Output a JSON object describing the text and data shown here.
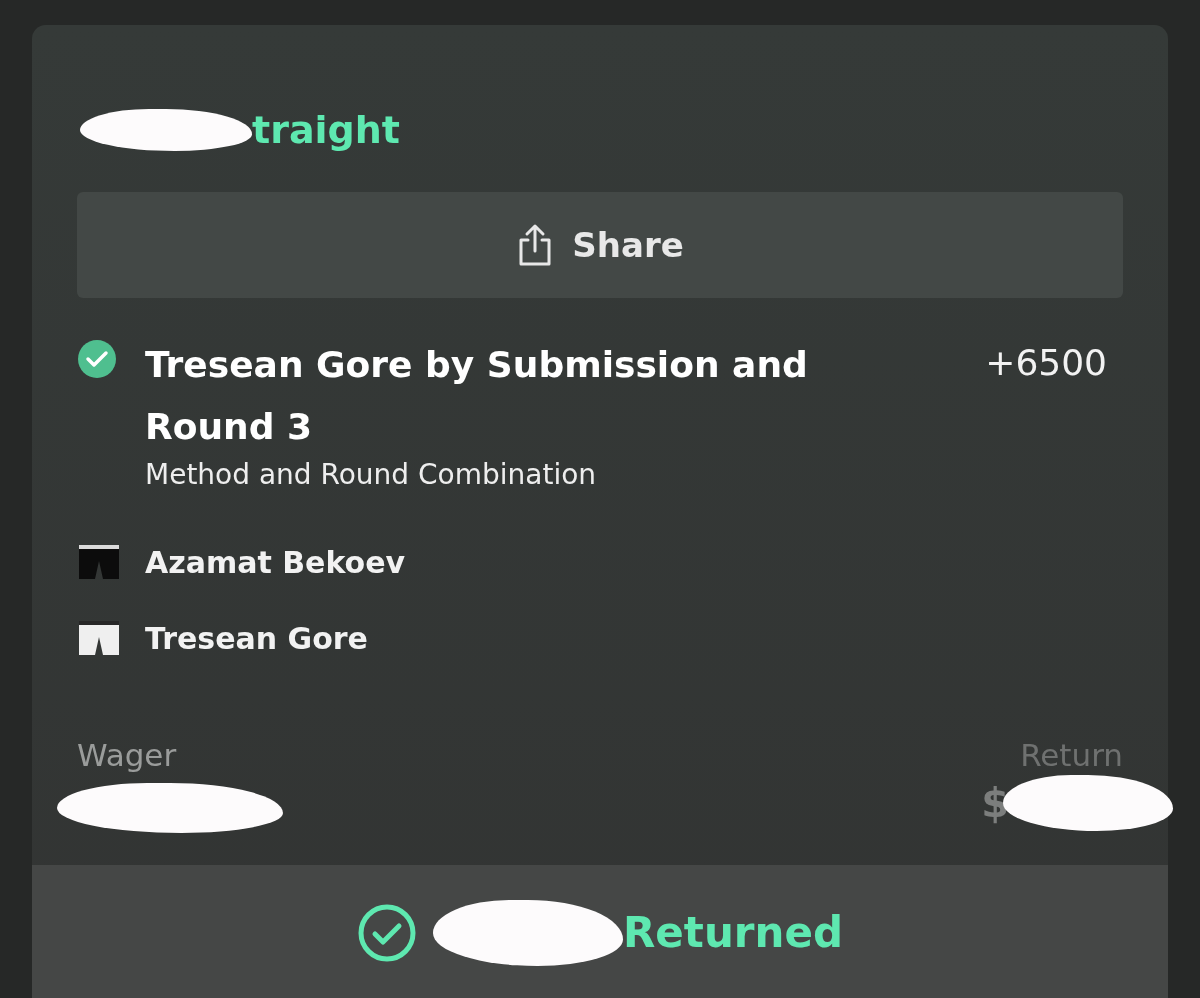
{
  "bet_type": {
    "text": "traight",
    "redacted": true
  },
  "share_button": {
    "label": "Share"
  },
  "selection": {
    "title": "Tresean Gore by Submission and Round 3",
    "odds": "+6500",
    "market": "Method and Round Combination",
    "won": true
  },
  "fighters": [
    {
      "name": "Azamat Bekoev",
      "kind": "dark"
    },
    {
      "name": "Tresean Gore",
      "kind": "light"
    }
  ],
  "wager": {
    "label": "Wager",
    "redacted": true
  },
  "return": {
    "label": "Return",
    "value": "$",
    "redacted": true
  },
  "status_bar": {
    "text": "Returned",
    "redacted": true,
    "settled": true
  }
}
